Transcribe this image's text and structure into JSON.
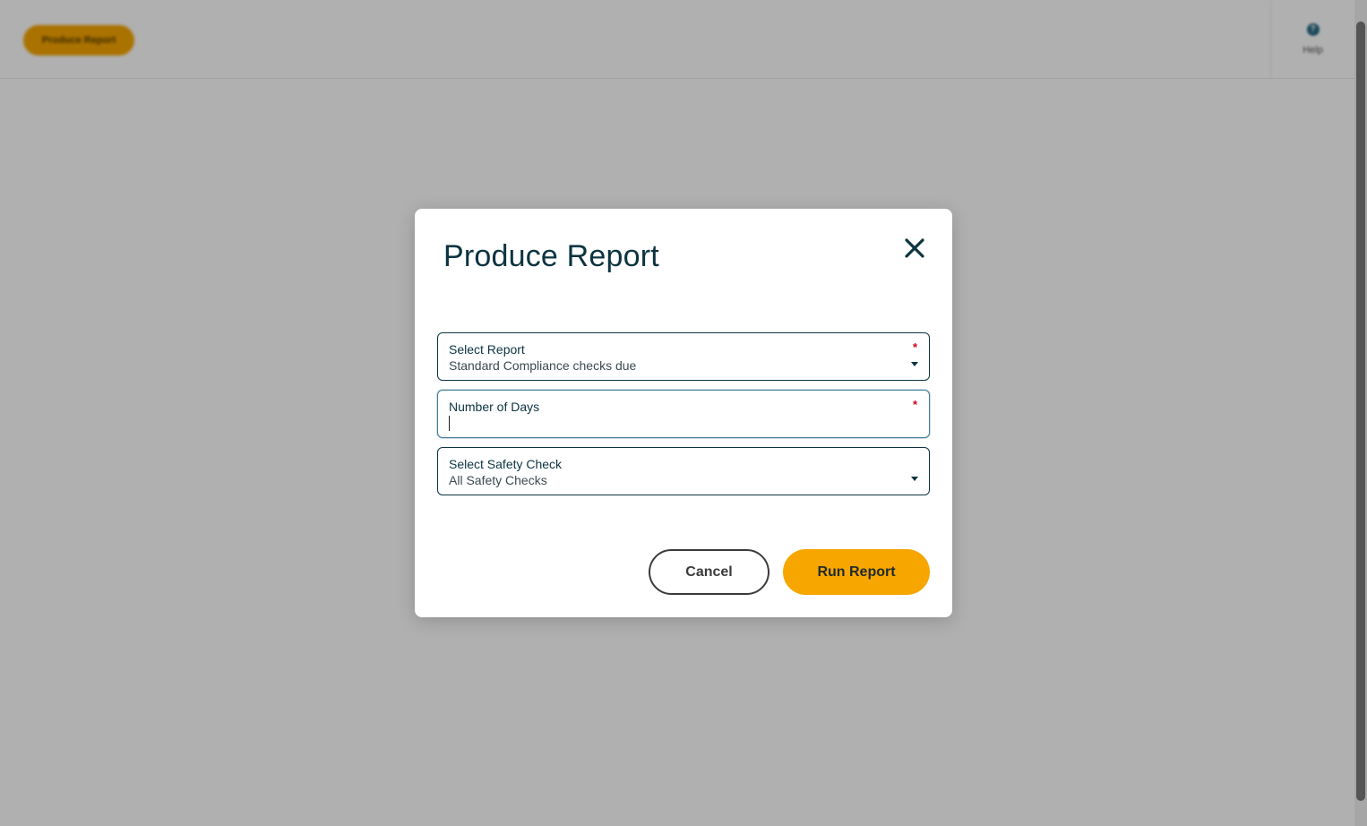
{
  "background": {
    "header_button_label": "Produce Report",
    "help_label": "Help"
  },
  "modal": {
    "title": "Produce Report",
    "close_icon": "close-icon",
    "fields": {
      "select_report": {
        "label": "Select Report",
        "value": "Standard Compliance checks due",
        "required_marker": "*"
      },
      "number_of_days": {
        "label": "Number of Days",
        "value": "",
        "required_marker": "*"
      },
      "select_safety_check": {
        "label": "Select Safety Check",
        "value": "All Safety Checks"
      }
    },
    "buttons": {
      "cancel": "Cancel",
      "run_report": "Run Report"
    }
  },
  "colors": {
    "accent": "#f7a600",
    "primary_text": "#0c3440",
    "required": "#d0021b"
  }
}
